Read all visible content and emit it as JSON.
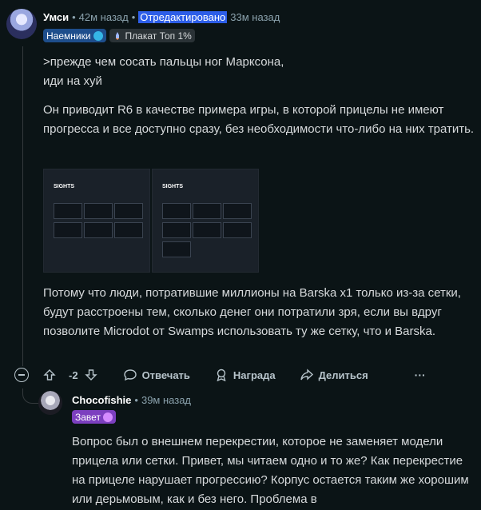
{
  "comment1": {
    "username": "Умси",
    "time": "42м назад",
    "edited_label": "Отредактировано",
    "edited_time": "33м назад",
    "flairs": [
      "Наемники",
      "Плакат Топ 1%"
    ],
    "paragraphs": [
      ">прежде чем сосать пальцы ног Марксона, иди на хуй",
      "Он приводит R6 в качестве примера игры, в которой прицелы не имеют прогресса и все доступно сразу, без необходимости что-либо на них тратить.",
      "Потому что люди, потратившие миллионы на Barska x1 только из-за сетки, будут расстроены тем, сколько денег они потратили зря, если вы вдруг позволите Microdot от Swamps использовать ту же сетку, что и Barska."
    ],
    "image": {
      "left_title": "SIGHTS",
      "right_title": "SIGHTS"
    },
    "actions": {
      "score": "-2",
      "reply": "Отвечать",
      "award": "Награда",
      "share": "Делиться",
      "more": "···"
    }
  },
  "comment2": {
    "username": "Chocofishie",
    "time": "39м назад",
    "flair": "Завет",
    "paragraph": "Вопрос был о внешнем перекрестии, которое не заменяет модели прицела или сетки. Привет, мы читаем одно и то же? Как перекрестие на прицеле нарушает прогрессию? Корпус остается таким же хорошим или дерьмовым, как и без него. Проблема в"
  },
  "colors": {
    "background": "#0b1416",
    "accent_blue": "#2d5ee8",
    "flair_purple": "#7c3fbf"
  }
}
